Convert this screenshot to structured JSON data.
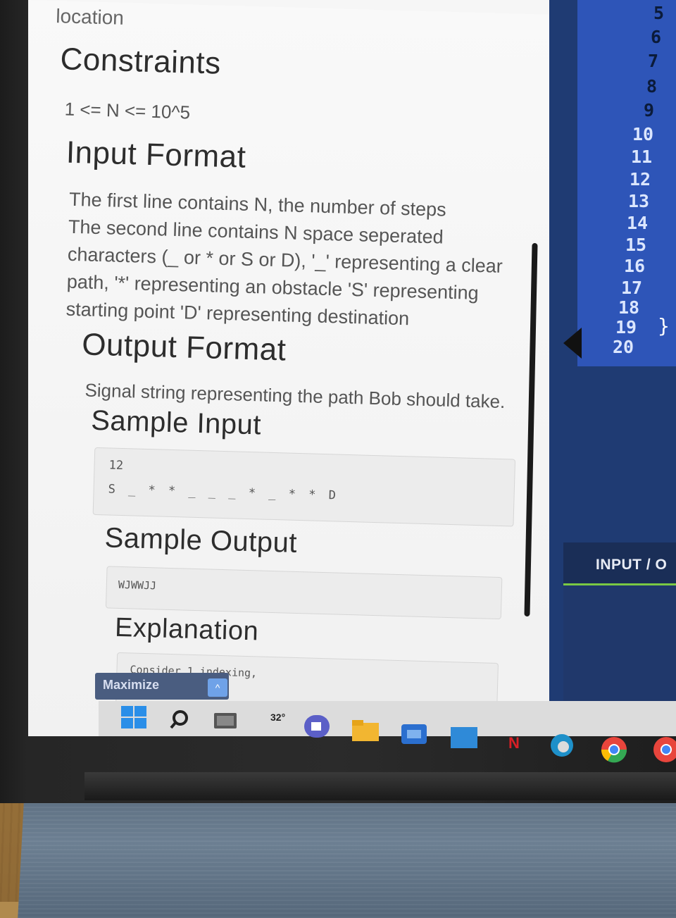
{
  "problem": {
    "section_location": "location",
    "constraints_heading": "Constraints",
    "constraints_text": "1 <= N <= 10^5",
    "input_format_heading": "Input Format",
    "input_format_lines": [
      "The first line contains N, the number of steps",
      "The second line contains N space seperated",
      "characters (_ or * or S or D), '_' representing a clear",
      "path, '*' representing an obstacle 'S' representing",
      "starting point 'D' representing destination"
    ],
    "output_format_heading": "Output Format",
    "output_format_text": "Signal string representing the path Bob should take.",
    "sample_input_heading": "Sample Input",
    "sample_input_line1": "12",
    "sample_input_line2": "S _ * * _ _ _ * _ * * D",
    "sample_output_heading": "Sample Output",
    "sample_output_text": "WJWWJJ",
    "explanation_heading": "Explanation",
    "explanation_text": "Consider 1 indexing,"
  },
  "editor": {
    "line_numbers": [
      "5",
      "6",
      "7",
      "8",
      "9",
      "10",
      "11",
      "12",
      "13",
      "14",
      "15",
      "16",
      "17",
      "18",
      "19",
      "20"
    ],
    "brace": "}",
    "io_label": "INPUT / O"
  },
  "taskbar": {
    "tooltip_label": "Maximize",
    "weather_temp": "32°"
  },
  "colors": {
    "editor_bg": "#1f3b73",
    "gutter_bg": "#2e55b8",
    "io_accent": "#7ac943"
  }
}
